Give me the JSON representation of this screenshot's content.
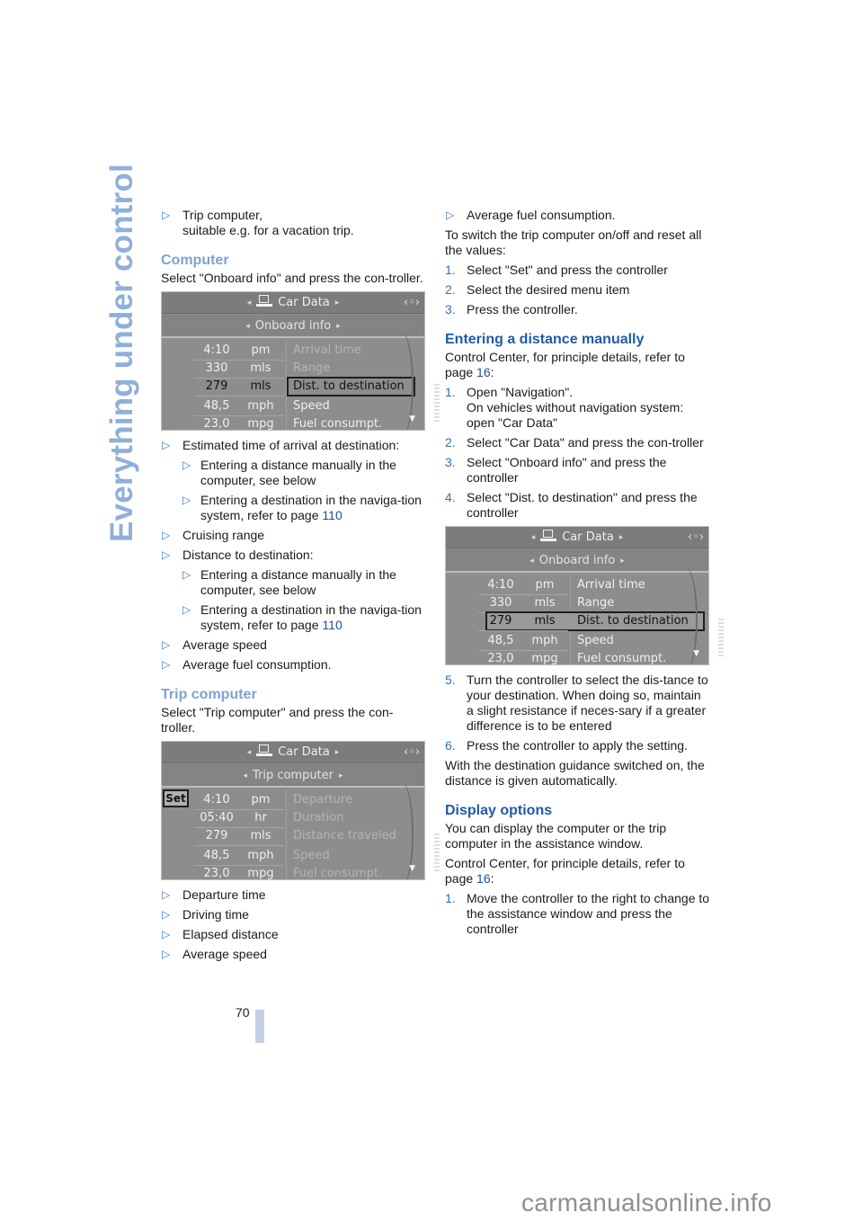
{
  "side_title": "Everything under control",
  "page_number": "70",
  "watermark": "carmanualsonline.info",
  "left_column": {
    "intro_bullet": [
      "Trip computer,",
      "suitable e.g. for a vacation trip."
    ],
    "computer": {
      "heading": "Computer",
      "text": "Select \"Onboard info\" and press the con-troller.",
      "screen": {
        "title": "Car Data",
        "subtitle": "Onboard info",
        "rows": [
          {
            "value": "4:10",
            "unit": "pm",
            "label": "Arrival time",
            "state": "dim"
          },
          {
            "value": "330",
            "unit": "mls",
            "label": "Range",
            "state": "dim"
          },
          {
            "value": "279",
            "unit": "mls",
            "label": "Dist. to destination",
            "state": "selected"
          },
          {
            "value": "48,5",
            "unit": "mph",
            "label": "Speed",
            "state": "normal"
          },
          {
            "value": "23,0",
            "unit": "mpg",
            "label": "Fuel consumpt.",
            "state": "normal"
          }
        ]
      },
      "bullets": [
        {
          "text": "Estimated time of arrival at destination:",
          "sub": [
            {
              "text": "Entering a distance manually in the computer, see below"
            },
            {
              "text": "Entering a destination in the naviga-tion system, refer to page ",
              "link": "110"
            }
          ]
        },
        {
          "text": "Cruising range"
        },
        {
          "text": "Distance to destination:",
          "sub": [
            {
              "text": "Entering a distance manually in the computer, see below"
            },
            {
              "text": "Entering a destination in the naviga-tion system, refer to page ",
              "link": "110"
            }
          ]
        },
        {
          "text": "Average speed"
        },
        {
          "text": "Average fuel consumption."
        }
      ]
    },
    "trip_computer": {
      "heading": "Trip computer",
      "text": "Select \"Trip computer\" and press the con-troller.",
      "screen": {
        "title": "Car Data",
        "subtitle": "Trip computer",
        "set_label": "Set",
        "rows": [
          {
            "value": "4:10",
            "unit": "pm",
            "label": "Departure",
            "state": "dim"
          },
          {
            "value": "05:40",
            "unit": "hr",
            "label": "Duration",
            "state": "dim"
          },
          {
            "value": "279",
            "unit": "mls",
            "label": "Distance traveled",
            "state": "dim"
          },
          {
            "value": "48,5",
            "unit": "mph",
            "label": "Speed",
            "state": "dim"
          },
          {
            "value": "23,0",
            "unit": "mpg",
            "label": "Fuel consumpt.",
            "state": "dim"
          }
        ]
      },
      "bullets": [
        "Departure time",
        "Driving time",
        "Elapsed distance",
        "Average speed"
      ]
    }
  },
  "right_column": {
    "bullet": "Average fuel consumption.",
    "switch_text": "To switch the trip computer on/off and reset all the values:",
    "switch_steps": [
      {
        "n": "1.",
        "text": "Select \"Set\" and press the controller"
      },
      {
        "n": "2.",
        "text": "Select the desired menu item"
      },
      {
        "n": "3.",
        "text": "Press the controller."
      }
    ],
    "manual": {
      "heading": "Entering a distance manually",
      "intro": "Control Center, for principle details, refer to page ",
      "intro_link": "16",
      "intro_suffix": ":",
      "steps": [
        {
          "n": "1.",
          "lines": [
            "Open \"Navigation\".",
            "On vehicles without navigation system: open \"Car Data\""
          ]
        },
        {
          "n": "2.",
          "lines": [
            "Select \"Car Data\" and press the con-troller"
          ]
        },
        {
          "n": "3.",
          "lines": [
            "Select \"Onboard info\" and press the controller"
          ]
        },
        {
          "n": "4.",
          "lines": [
            "Select \"Dist. to destination\" and press the controller"
          ]
        }
      ],
      "screen": {
        "title": "Car Data",
        "subtitle": "Onboard info",
        "rows": [
          {
            "value": "4:10",
            "unit": "pm",
            "label": "Arrival time",
            "state": "normal"
          },
          {
            "value": "330",
            "unit": "mls",
            "label": "Range",
            "state": "normal"
          },
          {
            "value": "279",
            "unit": "mls",
            "label": "Dist. to destination",
            "state": "selected"
          },
          {
            "value": "48,5",
            "unit": "mph",
            "label": "Speed",
            "state": "normal"
          },
          {
            "value": "23,0",
            "unit": "mpg",
            "label": "Fuel consumpt.",
            "state": "normal"
          }
        ]
      },
      "steps_after": [
        {
          "n": "5.",
          "text": "Turn the controller to select the dis-tance to your destination. When doing so, maintain a slight resistance if neces-sary if a greater difference is to be entered"
        },
        {
          "n": "6.",
          "text": "Press the controller to apply the setting."
        }
      ],
      "outro": "With the destination guidance switched on, the distance is given automatically."
    },
    "display": {
      "heading": "Display options",
      "text1": "You can display the computer or the trip computer in the assistance window.",
      "intro": "Control Center, for principle details, refer to page ",
      "intro_link": "16",
      "intro_suffix": ":",
      "steps": [
        {
          "n": "1.",
          "text": "Move the controller to the right to change to the assistance window and press the controller"
        }
      ]
    }
  }
}
